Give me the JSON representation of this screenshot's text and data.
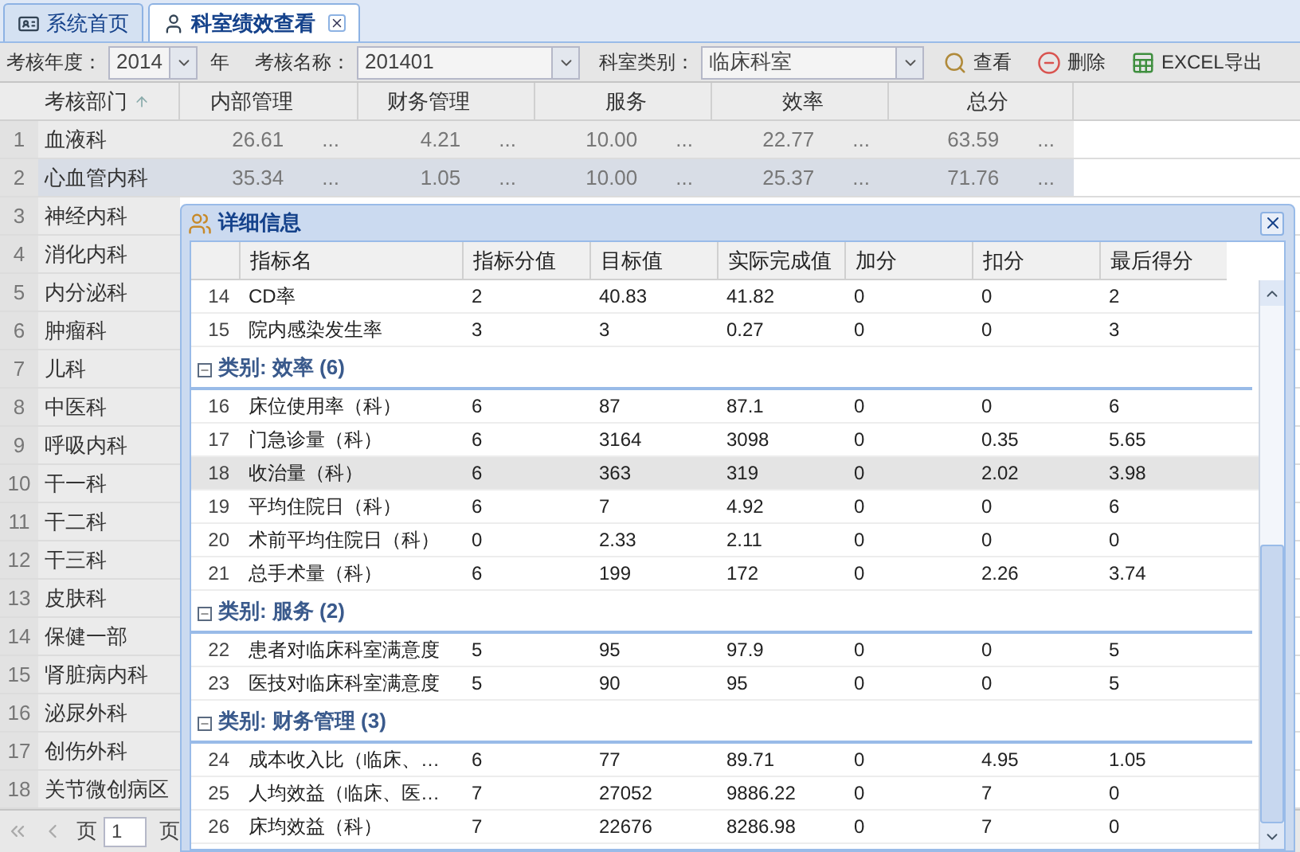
{
  "tabs": [
    {
      "label": "系统首页",
      "selected": false,
      "closable": false
    },
    {
      "label": "科室绩效查看",
      "selected": true,
      "closable": true
    }
  ],
  "toolbar": {
    "year_label": "考核年度：",
    "year": "2014",
    "year_unit": "年",
    "name_label": "考核名称：",
    "name": "201401",
    "type_label": "科室类别：",
    "type": "临床科室",
    "buttons": [
      {
        "kind": "search",
        "label": "查看"
      },
      {
        "kind": "delete",
        "label": "删除"
      },
      {
        "kind": "excel",
        "label": "EXCEL导出"
      }
    ]
  },
  "grid": {
    "columns": [
      {
        "label": "考核部门",
        "sorted": true
      },
      {
        "label": "内部管理",
        "sorted": false
      },
      {
        "label": "财务管理",
        "sorted": false
      },
      {
        "label": "服务",
        "sorted": false
      },
      {
        "label": "效率",
        "sorted": false
      },
      {
        "label": "总分",
        "sorted": false
      }
    ],
    "rows": [
      {
        "num": "1",
        "dept": "血液科",
        "selected": false,
        "values": [
          {
            "value": "26.61",
            "more": "..."
          },
          {
            "value": "4.21",
            "more": "..."
          },
          {
            "value": "10.00",
            "more": "..."
          },
          {
            "value": "22.77",
            "more": "..."
          },
          {
            "value": "63.59",
            "more": "..."
          }
        ]
      },
      {
        "num": "2",
        "dept": "心血管内科",
        "selected": true,
        "values": [
          {
            "value": "35.34",
            "more": "..."
          },
          {
            "value": "1.05",
            "more": "..."
          },
          {
            "value": "10.00",
            "more": "..."
          },
          {
            "value": "25.37",
            "more": "..."
          },
          {
            "value": "71.76",
            "more": "..."
          }
        ]
      },
      {
        "num": "3",
        "dept": "神经内科",
        "selected": false,
        "values": []
      },
      {
        "num": "4",
        "dept": "消化内科",
        "selected": false,
        "values": []
      },
      {
        "num": "5",
        "dept": "内分泌科",
        "selected": false,
        "values": []
      },
      {
        "num": "6",
        "dept": "肿瘤科",
        "selected": false,
        "values": []
      },
      {
        "num": "7",
        "dept": "儿科",
        "selected": false,
        "values": []
      },
      {
        "num": "8",
        "dept": "中医科",
        "selected": false,
        "values": []
      },
      {
        "num": "9",
        "dept": "呼吸内科",
        "selected": false,
        "values": []
      },
      {
        "num": "10",
        "dept": "干一科",
        "selected": false,
        "values": []
      },
      {
        "num": "11",
        "dept": "干二科",
        "selected": false,
        "values": []
      },
      {
        "num": "12",
        "dept": "干三科",
        "selected": false,
        "values": []
      },
      {
        "num": "13",
        "dept": "皮肤科",
        "selected": false,
        "values": []
      },
      {
        "num": "14",
        "dept": "保健一部",
        "selected": false,
        "values": []
      },
      {
        "num": "15",
        "dept": "肾脏病内科",
        "selected": false,
        "values": []
      },
      {
        "num": "16",
        "dept": "泌尿外科",
        "selected": false,
        "values": []
      },
      {
        "num": "17",
        "dept": "创伤外科",
        "selected": false,
        "values": []
      },
      {
        "num": "18",
        "dept": "关节微创病区",
        "selected": false,
        "values": []
      }
    ]
  },
  "pager": {
    "page_label": "页",
    "page": "1",
    "page_suffix": "页"
  },
  "detail": {
    "title": "详细信息",
    "columns": [
      "指标名",
      "指标分值",
      "目标值",
      "实际完成值",
      "加分",
      "扣分",
      "最后得分"
    ],
    "leading_rows": [
      {
        "num": "14",
        "selected": false,
        "cells": [
          "CD率",
          "2",
          "40.83",
          "41.82",
          "0",
          "0",
          "2"
        ]
      },
      {
        "num": "15",
        "selected": false,
        "cells": [
          "院内感染发生率",
          "3",
          "3",
          "0.27",
          "0",
          "0",
          "3"
        ]
      }
    ],
    "groups": [
      {
        "label": "类别: 效率 (6)",
        "expanded": true,
        "rows": [
          {
            "num": "16",
            "selected": false,
            "cells": [
              "床位使用率（科）",
              "6",
              "87",
              "87.1",
              "0",
              "0",
              "6"
            ]
          },
          {
            "num": "17",
            "selected": false,
            "cells": [
              "门急诊量（科）",
              "6",
              "3164",
              "3098",
              "0",
              "0.35",
              "5.65"
            ]
          },
          {
            "num": "18",
            "selected": true,
            "cells": [
              "收治量（科）",
              "6",
              "363",
              "319",
              "0",
              "2.02",
              "3.98"
            ]
          },
          {
            "num": "19",
            "selected": false,
            "cells": [
              "平均住院日（科）",
              "6",
              "7",
              "4.92",
              "0",
              "0",
              "6"
            ]
          },
          {
            "num": "20",
            "selected": false,
            "cells": [
              "术前平均住院日（科）",
              "0",
              "2.33",
              "2.11",
              "0",
              "0",
              "0"
            ]
          },
          {
            "num": "21",
            "selected": false,
            "cells": [
              "总手术量（科）",
              "6",
              "199",
              "172",
              "0",
              "2.26",
              "3.74"
            ]
          }
        ]
      },
      {
        "label": "类别: 服务 (2)",
        "expanded": true,
        "rows": [
          {
            "num": "22",
            "selected": false,
            "cells": [
              "患者对临床科室满意度",
              "5",
              "95",
              "97.9",
              "0",
              "0",
              "5"
            ]
          },
          {
            "num": "23",
            "selected": false,
            "cells": [
              "医技对临床科室满意度",
              "5",
              "90",
              "95",
              "0",
              "0",
              "5"
            ]
          }
        ]
      },
      {
        "label": "类别: 财务管理 (3)",
        "expanded": true,
        "rows": [
          {
            "num": "24",
            "selected": false,
            "cells": [
              "成本收入比（临床、…",
              "6",
              "77",
              "89.71",
              "0",
              "4.95",
              "1.05"
            ]
          },
          {
            "num": "25",
            "selected": false,
            "cells": [
              "人均效益（临床、医…",
              "7",
              "27052",
              "9886.22",
              "0",
              "7",
              "0"
            ]
          },
          {
            "num": "26",
            "selected": false,
            "cells": [
              "床均效益（科）",
              "7",
              "22676",
              "8286.98",
              "0",
              "7",
              "0"
            ]
          }
        ]
      }
    ]
  }
}
